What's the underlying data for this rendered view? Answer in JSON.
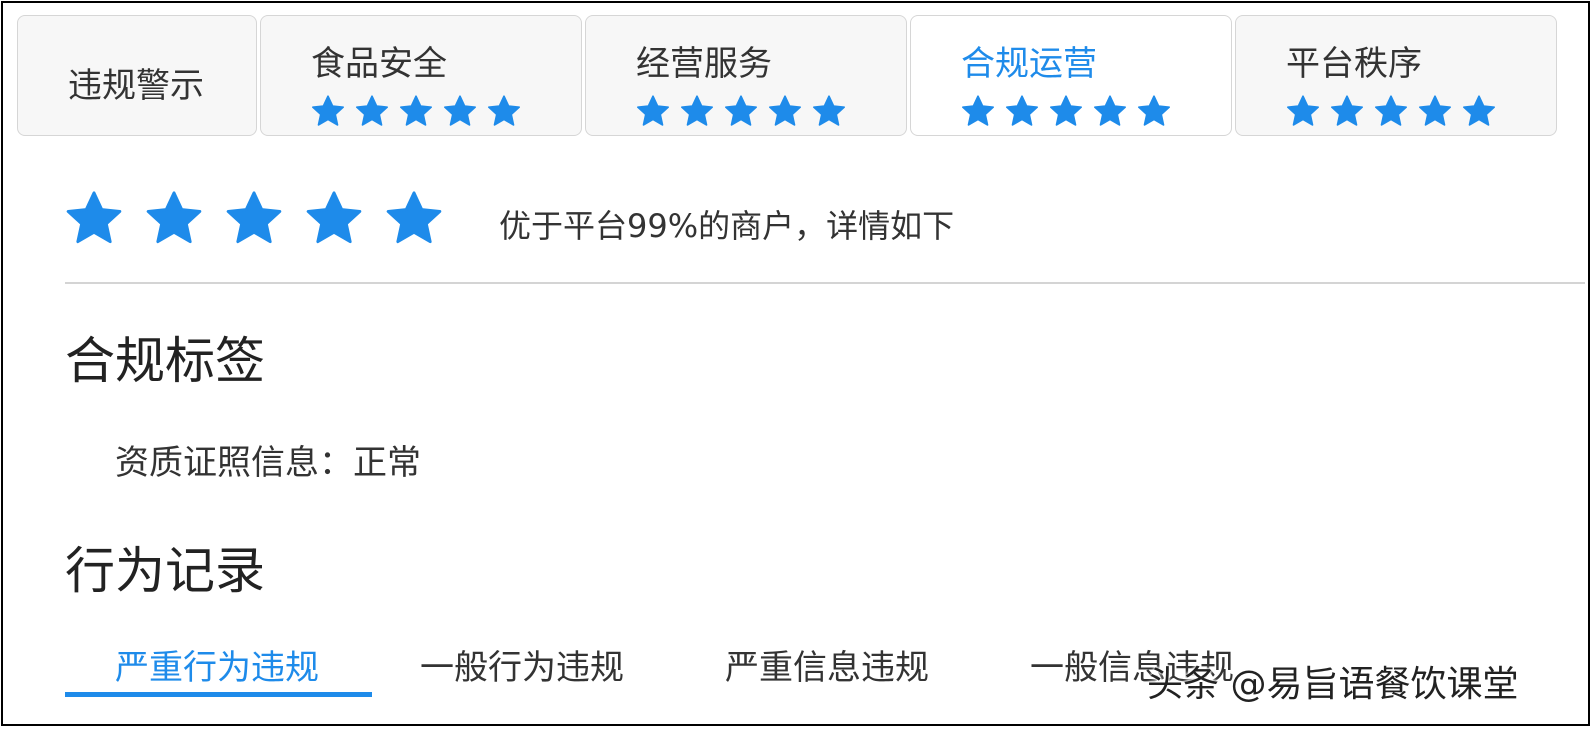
{
  "colors": {
    "accent": "#1e8bea",
    "star": "#1e8bea",
    "tab_bg": "#f7f7f7",
    "divider": "#d4d4d4"
  },
  "tabs": [
    {
      "label": "违规警示",
      "stars": 0,
      "active": false
    },
    {
      "label": "食品安全",
      "stars": 5,
      "active": false
    },
    {
      "label": "经营服务",
      "stars": 5,
      "active": false
    },
    {
      "label": "合规运营",
      "stars": 5,
      "active": true
    },
    {
      "label": "平台秩序",
      "stars": 5,
      "active": false
    }
  ],
  "summary": {
    "rating_stars": 5,
    "text": "优于平台99%的商户，详情如下"
  },
  "compliance": {
    "title": "合规标签",
    "item": "资质证照信息：正常"
  },
  "records": {
    "title": "行为记录",
    "tabs": [
      {
        "label": "严重行为违规",
        "active": true
      },
      {
        "label": "一般行为违规",
        "active": false
      },
      {
        "label": "严重信息违规",
        "active": false
      },
      {
        "label": "一般信息违规",
        "active": false
      }
    ]
  },
  "watermark": "头条 @易旨语餐饮课堂",
  "icons": {
    "star": "star-icon"
  }
}
